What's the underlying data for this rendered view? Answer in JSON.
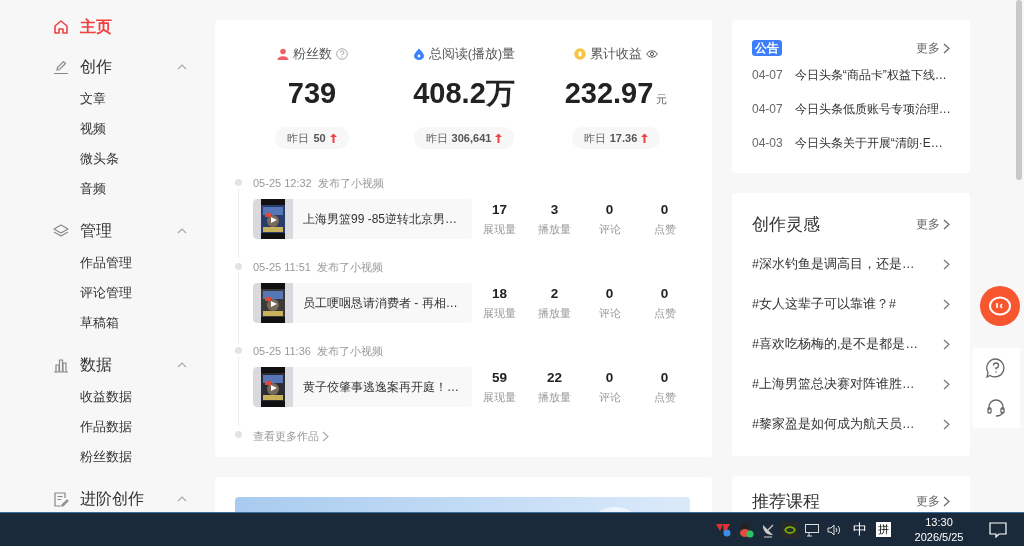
{
  "sidebar": {
    "items": [
      {
        "kind": "link",
        "label": "主页",
        "selected": true
      },
      {
        "kind": "group",
        "label": "创作",
        "selected": false,
        "expanded": true,
        "children": [
          {
            "label": "文章",
            "selected": false
          },
          {
            "label": "视频",
            "selected": false
          },
          {
            "label": "微头条",
            "selected": false
          },
          {
            "label": "音频",
            "selected": false
          }
        ]
      },
      {
        "kind": "group",
        "label": "管理",
        "selected": false,
        "expanded": true,
        "children": [
          {
            "label": "作品管理",
            "selected": false
          },
          {
            "label": "评论管理",
            "selected": false
          },
          {
            "label": "草稿箱",
            "selected": false
          }
        ]
      },
      {
        "kind": "group",
        "label": "数据",
        "selected": false,
        "expanded": true,
        "children": [
          {
            "label": "收益数据",
            "selected": false
          },
          {
            "label": "作品数据",
            "selected": false
          },
          {
            "label": "粉丝数据",
            "selected": false
          }
        ]
      },
      {
        "kind": "group",
        "label": "进阶创作",
        "selected": false,
        "expanded": true
      }
    ]
  },
  "overview": {
    "stats": [
      {
        "label": "粉丝数",
        "value": "739",
        "yesterday_label": "昨日",
        "yesterday_value": "50",
        "rising": true
      },
      {
        "label": "总阅读(播放)量",
        "value": "408.2万",
        "yesterday_label": "昨日",
        "yesterday_value": "306,641",
        "rising": true
      },
      {
        "label": "累计收益",
        "value": "232.97",
        "unit": "元",
        "yesterday_label": "昨日",
        "yesterday_value": "17.36",
        "rising": true
      }
    ],
    "works": [
      {
        "time": "05-25 12:32",
        "action": "发布了小视频",
        "title": "上海男篮99 -85逆转北京男…",
        "metrics": [
          {
            "value": "17",
            "label": "展现量"
          },
          {
            "value": "3",
            "label": "播放量"
          },
          {
            "value": "0",
            "label": "评论"
          },
          {
            "value": "0",
            "label": "点赞"
          }
        ]
      },
      {
        "time": "05-25 11:51",
        "action": "发布了小视频",
        "title": "员工哽咽恳请消费者 - 再相…",
        "metrics": [
          {
            "value": "18",
            "label": "展现量"
          },
          {
            "value": "2",
            "label": "播放量"
          },
          {
            "value": "0",
            "label": "评论"
          },
          {
            "value": "0",
            "label": "点赞"
          }
        ]
      },
      {
        "time": "05-25 11:36",
        "action": "发布了小视频",
        "title": "黄子佼肇事逃逸案再开庭！…",
        "metrics": [
          {
            "value": "59",
            "label": "展现量"
          },
          {
            "value": "22",
            "label": "播放量"
          },
          {
            "value": "0",
            "label": "评论"
          },
          {
            "value": "0",
            "label": "点赞"
          }
        ]
      }
    ],
    "more_works": "查看更多作品"
  },
  "announcements": {
    "badge": "公告",
    "more": "更多",
    "items": [
      {
        "date": "04-07",
        "title": "今日头条“商品卡”权益下线…"
      },
      {
        "date": "04-07",
        "title": "今日头条低质账号专项治理…"
      },
      {
        "date": "04-03",
        "title": "今日头条关于开展“清朗·E…"
      }
    ]
  },
  "inspiration": {
    "title": "创作灵感",
    "more": "更多",
    "items": [
      "#深水钓鱼是调高目，还是…",
      "#女人这辈子可以靠谁？#",
      "#喜欢吃杨梅的,是不是都是…",
      "#上海男篮总决赛对阵谁胜…",
      "#黎家盈是如何成为航天员…"
    ]
  },
  "courses": {
    "title": "推荐课程",
    "more": "更多"
  },
  "taskbar": {
    "ime_mode": "中",
    "ime": "拼",
    "time": "13:30",
    "date": "2026/5/25"
  }
}
